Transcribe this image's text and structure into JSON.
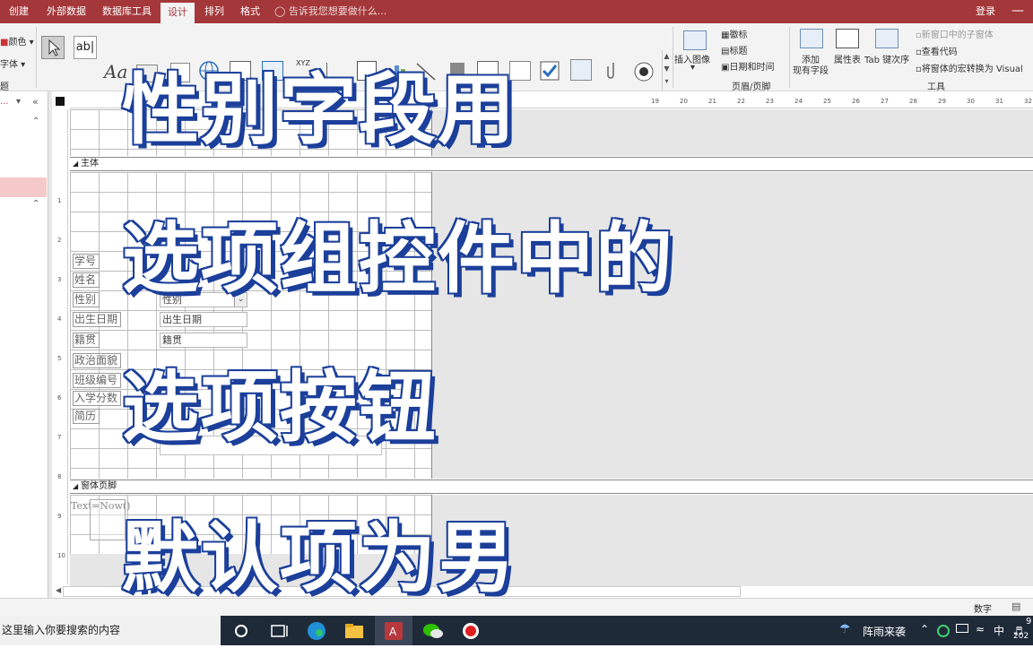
{
  "ribbon_tabs": [
    "创建",
    "外部数据",
    "数据库工具",
    "设计",
    "排列",
    "格式"
  ],
  "active_tab": "设计",
  "tell_me_placeholder": "告诉我您想要做什么...",
  "login_label": "登录",
  "left_group": {
    "color_label": "颜色",
    "font_label": "字体",
    "group_label": "题"
  },
  "controls": {
    "textbox_label": "ab|",
    "label_label": "Aa",
    "xyz_label": "XYZ"
  },
  "header_footer_group": {
    "insert_image": "插入图像",
    "logo": "徽标",
    "title": "标题",
    "date_time": "日期和时间",
    "group_label": "页眉/页脚"
  },
  "tools_group": {
    "add_existing_fields": "添加现有字段",
    "add_existing_fields_line1": "添加",
    "add_existing_fields_line2": "现有字段",
    "property_sheet": "属性表",
    "tab_order": "Tab 键次序",
    "new_subform": "新窗口中的子窗体",
    "view_code": "查看代码",
    "convert_macros": "将窗体的宏转换为 Visual",
    "group_label": "工具"
  },
  "ruler_numbers": [
    "19",
    "20",
    "21",
    "22",
    "23",
    "24",
    "25",
    "26",
    "27",
    "28",
    "29",
    "30",
    "31",
    "32"
  ],
  "vruler_numbers": [
    "1",
    "2",
    "3",
    "4",
    "5",
    "6",
    "7",
    "8",
    "9",
    "10"
  ],
  "sections": {
    "detail": "主体",
    "footer": "窗体页脚"
  },
  "form_labels": [
    "学号",
    "姓名",
    "性别",
    "出生日期",
    "籍贯",
    "政治面貌",
    "班级编号",
    "入学分数",
    "简历"
  ],
  "form_fields": {
    "gender": "性别",
    "birth_date": "出生日期",
    "native_place": "籍贯"
  },
  "footer_textbox": "Text",
  "footer_expression": "=Now()",
  "status_bar": {
    "mode": "数字"
  },
  "taskbar": {
    "search_placeholder": "这里输入你要搜索的内容",
    "weather": "阵雨来袭",
    "ime": "中",
    "time": "9",
    "date": "202"
  },
  "overlay_caption": [
    "性别字段用",
    "选项组控件中的",
    "选项按钮",
    "默认项为男"
  ],
  "colors": {
    "title_bar": "#a4373a",
    "caption_fill": "#ffffff",
    "caption_outline": "#1b3f9a",
    "taskbar": "#1f2a38"
  }
}
